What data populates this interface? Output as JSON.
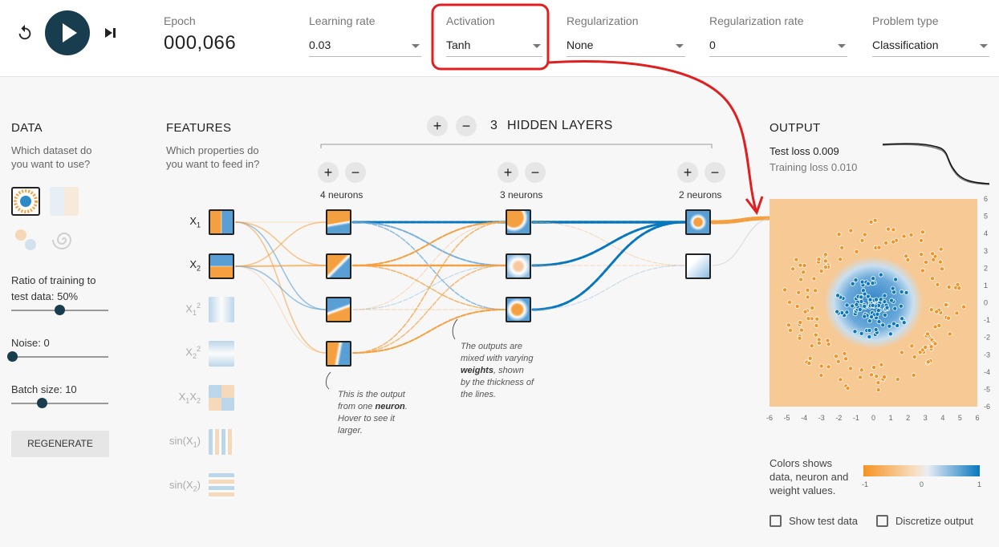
{
  "controls": {
    "reset_icon": "reset-icon",
    "play_icon": "play-icon",
    "step_icon": "step-forward-icon"
  },
  "epoch": {
    "label": "Epoch",
    "value": "000,066"
  },
  "learning_rate": {
    "label": "Learning rate",
    "value": "0.03"
  },
  "activation": {
    "label": "Activation",
    "value": "Tanh"
  },
  "regularization": {
    "label": "Regularization",
    "value": "None"
  },
  "regularization_rate": {
    "label": "Regularization rate",
    "value": "0"
  },
  "problem_type": {
    "label": "Problem type",
    "value": "Classification"
  },
  "data": {
    "title": "DATA",
    "subtitle_1": "Which dataset do",
    "subtitle_2": "you want to use?",
    "ratio_label": "Ratio of training to",
    "ratio_label_2": "test data:  50%",
    "ratio_value": 0.5,
    "noise_label": "Noise:  0",
    "noise_value": 0,
    "batch_label": "Batch size:  10",
    "batch_value": 0.31,
    "regenerate": "REGENERATE"
  },
  "features": {
    "title": "FEATURES",
    "subtitle_1": "Which properties do",
    "subtitle_2": "you want to feed in?"
  },
  "hidden": {
    "count": "3",
    "title": "HIDDEN LAYERS",
    "add": "+",
    "remove": "−",
    "layer1": "4 neurons",
    "layer2": "3 neurons",
    "layer3": "2 neurons"
  },
  "annotations": {
    "neuron_1": "This is the output",
    "neuron_2": "from one",
    "neuron_bold": "neuron",
    "neuron_3": "Hover to see it",
    "neuron_4": "larger.",
    "weights_1": "The outputs are",
    "weights_2": "mixed with varying",
    "weights_bold": "weights",
    "weights_3": ", shown",
    "weights_4": "by the thickness of",
    "weights_5": "the lines."
  },
  "output": {
    "title": "OUTPUT",
    "test_loss_label": "Test loss",
    "test_loss": "0.009",
    "train_loss_label": "Training loss",
    "train_loss": "0.010",
    "x_ticks": [
      "-6",
      "-5",
      "-4",
      "-3",
      "-2",
      "-1",
      "0",
      "1",
      "2",
      "3",
      "4",
      "5",
      "6"
    ],
    "y_ticks": [
      "6",
      "5",
      "4",
      "3",
      "2",
      "1",
      "0",
      "-1",
      "-2",
      "-3",
      "-4",
      "-5",
      "-6"
    ],
    "legend_1": "Colors shows",
    "legend_2": "data, neuron and",
    "legend_3": "weight values.",
    "legend_min": "-1",
    "legend_mid": "0",
    "legend_max": "1",
    "show_test": "Show test data",
    "discretize": "Discretize output"
  },
  "colors": {
    "orange": "#f59322",
    "blue": "#0877bd",
    "navy": "#183d4e",
    "annotation_red": "#e02020"
  }
}
